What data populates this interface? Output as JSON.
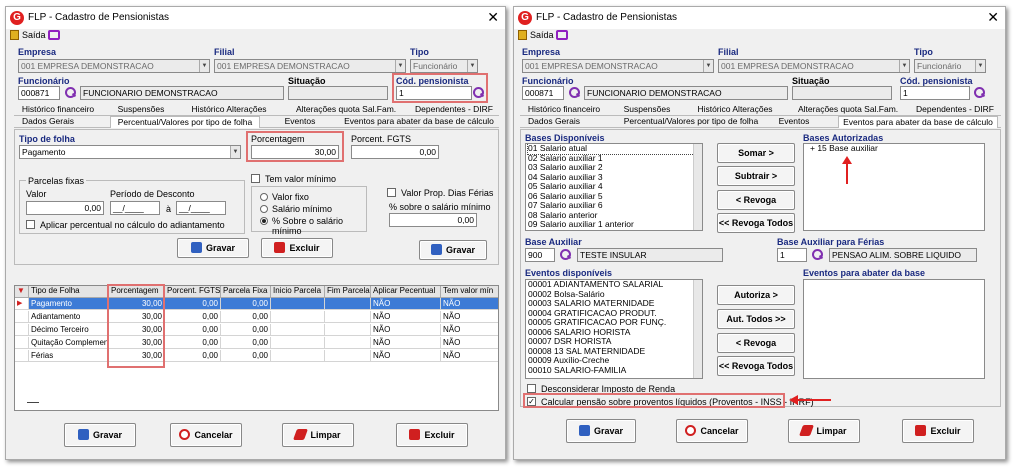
{
  "left": {
    "title": "FLP - Cadastro de Pensionistas",
    "menu_saida": "Saída",
    "empresa_label": "Empresa",
    "empresa_value": "001 EMPRESA DEMONSTRACAO",
    "filial_label": "Filial",
    "filial_value": "001 EMPRESA DEMONSTRACAO",
    "tipo_label": "Tipo",
    "tipo_value": "Funcionário",
    "funcionario_label": "Funcionário",
    "funcionario_code": "000871",
    "funcionario_name": "FUNCIONARIO DEMONSTRACAO",
    "situacao_label": "Situação",
    "cod_label": "Cód. pensionista",
    "cod_value": "1",
    "tabs_row1": [
      "Histórico financeiro",
      "Suspensões",
      "Histórico Alterações",
      "Alterações quota Sal.Fam.",
      "Dependentes - DIRF"
    ],
    "tabs_row2": [
      "Dados Gerais",
      "Percentual/Valores por tipo de folha",
      "Eventos",
      "Eventos para abater da base de cálculo"
    ],
    "tipo_folha_label": "Tipo de folha",
    "tipo_folha_value": "Pagamento",
    "porcentagem_label": "Porcentagem",
    "porcentagem_value": "30,00",
    "porcent_fgts_label": "Porcent. FGTS",
    "porcent_fgts_value": "0,00",
    "parcelas_label": "Parcelas fixas",
    "valor_label": "Valor",
    "valor_value": "0,00",
    "periodo_label": "Período de Desconto",
    "periodo_from": "__/____",
    "periodo_sep": "à",
    "periodo_to": "__/____",
    "aplicar_label": "Aplicar percentual no cálculo do adiantamento",
    "tem_valor_label": "Tem valor mínimo",
    "valor_fixo_label": "Valor fixo",
    "salario_minimo_label": "Salário mínimo",
    "pct_salario_label": "% Sobre o salário mínimo",
    "valor_prop_label": "Valor Prop. Dias Férias",
    "pct_sal_min_label": "% sobre o salário mínimo",
    "pct_sal_min_value": "0,00",
    "gravar_label": "Gravar",
    "excluir_label": "Excluir",
    "gravar2_label": "Gravar",
    "grid_headers": [
      "Tipo de Folha",
      "Porcentagem",
      "Porcent. FGTS",
      "Parcela Fixa",
      "Inicio Parcela",
      "Fim Parcela",
      "Aplicar Pecentual",
      "Tem valor mín"
    ],
    "grid_rows": [
      [
        "Pagamento",
        "30,00",
        "0,00",
        "0,00",
        "",
        "",
        "NÃO",
        "NÃO"
      ],
      [
        "Adiantamento",
        "30,00",
        "0,00",
        "0,00",
        "",
        "",
        "NÃO",
        "NÃO"
      ],
      [
        "Décimo Terceiro",
        "30,00",
        "0,00",
        "0,00",
        "",
        "",
        "NÃO",
        "NÃO"
      ],
      [
        "Quitação Complementar",
        "30,00",
        "0,00",
        "0,00",
        "",
        "",
        "NÃO",
        "NÃO"
      ],
      [
        "Férias",
        "30,00",
        "0,00",
        "0,00",
        "",
        "",
        "NÃO",
        "NÃO"
      ]
    ],
    "footer": {
      "gravar": "Gravar",
      "cancelar": "Cancelar",
      "limpar": "Limpar",
      "excluir": "Excluir"
    }
  },
  "right": {
    "title": "FLP - Cadastro de Pensionistas",
    "menu_saida": "Saída",
    "empresa_label": "Empresa",
    "empresa_value": "001 EMPRESA DEMONSTRACAO",
    "filial_label": "Filial",
    "filial_value": "001 EMPRESA DEMONSTRACAO",
    "tipo_label": "Tipo",
    "tipo_value": "Funcionário",
    "funcionario_label": "Funcionário",
    "funcionario_code": "000871",
    "funcionario_name": "FUNCIONARIO DEMONSTRACAO",
    "situacao_label": "Situação",
    "cod_label": "Cód. pensionista",
    "cod_value": "1",
    "tabs_row1": [
      "Histórico financeiro",
      "Suspensões",
      "Histórico Alterações",
      "Alterações quota Sal.Fam.",
      "Dependentes - DIRF"
    ],
    "tabs_row2": [
      "Dados Gerais",
      "Percentual/Valores por tipo de folha",
      "Eventos",
      "Eventos para abater da base de cálculo"
    ],
    "bases_disp_label": "Bases Disponíveis",
    "bases_disp": [
      "01 Salario atual",
      "02 Salario auxiliar 1",
      "03 Salario auxiliar 2",
      "04 Salario auxiliar 3",
      "05 Salario auxiliar 4",
      "06 Salario auxiliar 5",
      "07 Salario auxiliar 6",
      "08 Salario anterior",
      "09 Salario auxiliar 1 anterior"
    ],
    "bases_aut_label": "Bases Autorizadas",
    "bases_aut": [
      "+ 15 Base auxiliar"
    ],
    "somar_label": "Somar >",
    "subtrair_label": "Subtrair >",
    "revoga_label": "< Revoga",
    "revoga_todos_label": "<< Revoga Todos",
    "base_aux_label": "Base Auxiliar",
    "base_aux_code": "900",
    "base_aux_name": "TESTE INSULAR",
    "base_aux_ferias_label": "Base Auxiliar para Férias",
    "base_aux_ferias_code": "1",
    "base_aux_ferias_name": "PENSAO ALIM. SOBRE LIQUIDO",
    "eventos_disp_label": "Eventos disponíveis",
    "eventos_disp": [
      "00001 ADIANTAMENTO SALARIAL",
      "00002 Bolsa-Salário",
      "00003 SALARIO MATERNIDADE",
      "00004 GRATIFICACAO PRODUT.",
      "00005 GRATIFICACAO POR FUNÇ.",
      "00006 SALARIO HORISTA",
      "00007 DSR HORISTA",
      "00008 13 SAL MATERNIDADE",
      "00009 Auxílio-Creche",
      "00010 SALARIO-FAMILIA"
    ],
    "eventos_abater_label": "Eventos para abater da base",
    "autoriza_label": "Autoriza >",
    "aut_todos_label": "Aut. Todos >>",
    "revoga2_label": "< Revoga",
    "revoga_todos2_label": "<< Revoga Todos",
    "desconsiderar_label": "Desconsiderar Imposto de Renda",
    "calcular_label": "Calcular pensão sobre proventos líquidos (Proventos - INSS - IRRF)",
    "footer": {
      "gravar": "Gravar",
      "cancelar": "Cancelar",
      "limpar": "Limpar",
      "excluir": "Excluir"
    }
  },
  "colors": {
    "accent_red": "#e02020",
    "highlight_box": "#e07070",
    "label_blue": "#1a2a80",
    "icon_purple": "#8030b0",
    "selected_row": "#3d7bd6"
  }
}
